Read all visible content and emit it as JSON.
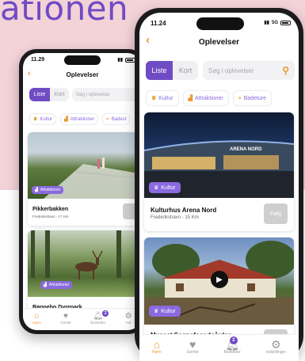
{
  "headline": "ationen",
  "back_phone": {
    "status_time": "11.29",
    "nav_title": "Oplevelser",
    "view_toggle": {
      "active": "Liste",
      "inactive": "Kort"
    },
    "search_placeholder": "Søg i oplevelser",
    "chips": [
      {
        "icon": "culture-icon",
        "label": "Kultur"
      },
      {
        "icon": "attraction-icon",
        "label": "Attraktioner"
      },
      {
        "icon": "beach-icon",
        "label": "Badest"
      }
    ],
    "cards": [
      {
        "tag": "Attraktioner",
        "title": "Pikkerbakken",
        "sub": "Frederikshavn - 17 Km"
      },
      {
        "tag": "Attraktioner",
        "title": "Rønnebo Dyrepark",
        "sub": ""
      }
    ],
    "tabs": [
      {
        "icon": "home-icon",
        "label": "Hjem",
        "active": true
      },
      {
        "icon": "heart-icon",
        "label": "Gemte",
        "active": false
      },
      {
        "icon": "bell-icon",
        "label": "Beskeder",
        "active": false,
        "badge": "2"
      },
      {
        "icon": "gear-icon",
        "label": "Ind",
        "active": false
      }
    ]
  },
  "front_phone": {
    "status_time": "11.24",
    "status_network": "5G",
    "nav_title": "Oplevelser",
    "view_toggle": {
      "active": "Liste",
      "inactive": "Kort"
    },
    "search_placeholder": "Søg i oplevelser",
    "chips": [
      {
        "icon": "culture-icon",
        "label": "Kultur"
      },
      {
        "icon": "attraction-icon",
        "label": "Attraktioner"
      },
      {
        "icon": "beach-icon",
        "label": "Badeture"
      }
    ],
    "cards": [
      {
        "tag": "Kultur",
        "title": "Kulturhus Arena Nord",
        "sub": "Frederikshavn - 15 Km",
        "follow": "Følg",
        "sign": "ARENA NORD"
      },
      {
        "tag": "Kultur",
        "title": "Museet Sognefogedgården",
        "sub": "",
        "follow": ""
      }
    ],
    "tabs": [
      {
        "icon": "home-icon",
        "label": "Hjem",
        "active": true
      },
      {
        "icon": "heart-icon",
        "label": "Gemte",
        "active": false
      },
      {
        "icon": "bell-icon",
        "label": "Beskeder",
        "active": false,
        "badge": "2"
      },
      {
        "icon": "gear-icon",
        "label": "Indstillinger",
        "active": false
      }
    ]
  },
  "colors": {
    "accent_purple": "#6f4bc4",
    "accent_orange": "#e79b2d",
    "background_pink": "#f3d2d8"
  }
}
